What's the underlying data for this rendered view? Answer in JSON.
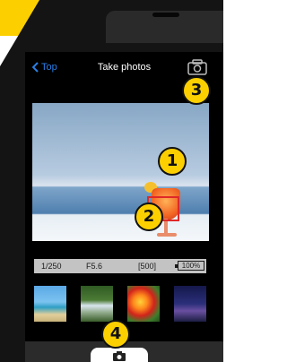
{
  "nav": {
    "back_label": "Top",
    "title": "Take photos"
  },
  "status": {
    "shutter_speed": "1/250",
    "aperture": "F5.6",
    "shots_remaining": "[500]",
    "battery": "100%"
  },
  "callouts": [
    "1",
    "2",
    "3",
    "4"
  ],
  "thumbnails": [
    {
      "name": "beach"
    },
    {
      "name": "waterfall"
    },
    {
      "name": "flower"
    },
    {
      "name": "night-city"
    }
  ],
  "icons": {
    "back": "chevron-left-icon",
    "camera": "camera-icon",
    "shutter": "camera-icon"
  },
  "colors": {
    "accent": "#2a7fe6",
    "banner": "#fcd000",
    "focus": "#e02828"
  }
}
